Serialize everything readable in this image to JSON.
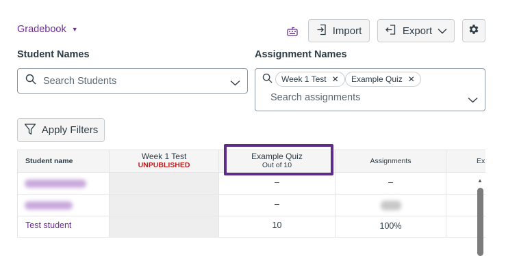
{
  "header": {
    "gradebook_label": "Gradebook",
    "import_label": "Import",
    "export_label": "Export"
  },
  "filters": {
    "students_label": "Student Names",
    "students_placeholder": "Search Students",
    "assignments_label": "Assignment Names",
    "assignment_pills": [
      "Week 1 Test",
      "Example Quiz"
    ],
    "assignments_placeholder": "Search assignments",
    "apply_label": "Apply Filters"
  },
  "grid": {
    "columns": {
      "name": "Student name",
      "week1": "Week 1 Test",
      "week1_status": "UNPUBLISHED",
      "quiz": "Example Quiz",
      "quiz_points": "Out of 10",
      "assignments": "Assignments",
      "extra": "Ex"
    },
    "rows": [
      {
        "student": "",
        "quiz": "–",
        "assignments": "–"
      },
      {
        "student": "",
        "quiz": "–",
        "assignments": ""
      },
      {
        "student": "Test student",
        "quiz": "10",
        "assignments": "100%"
      }
    ]
  },
  "colors": {
    "accent": "#6b2c91",
    "highlight": "#5c2c86",
    "unpublished": "#c21c1c"
  }
}
